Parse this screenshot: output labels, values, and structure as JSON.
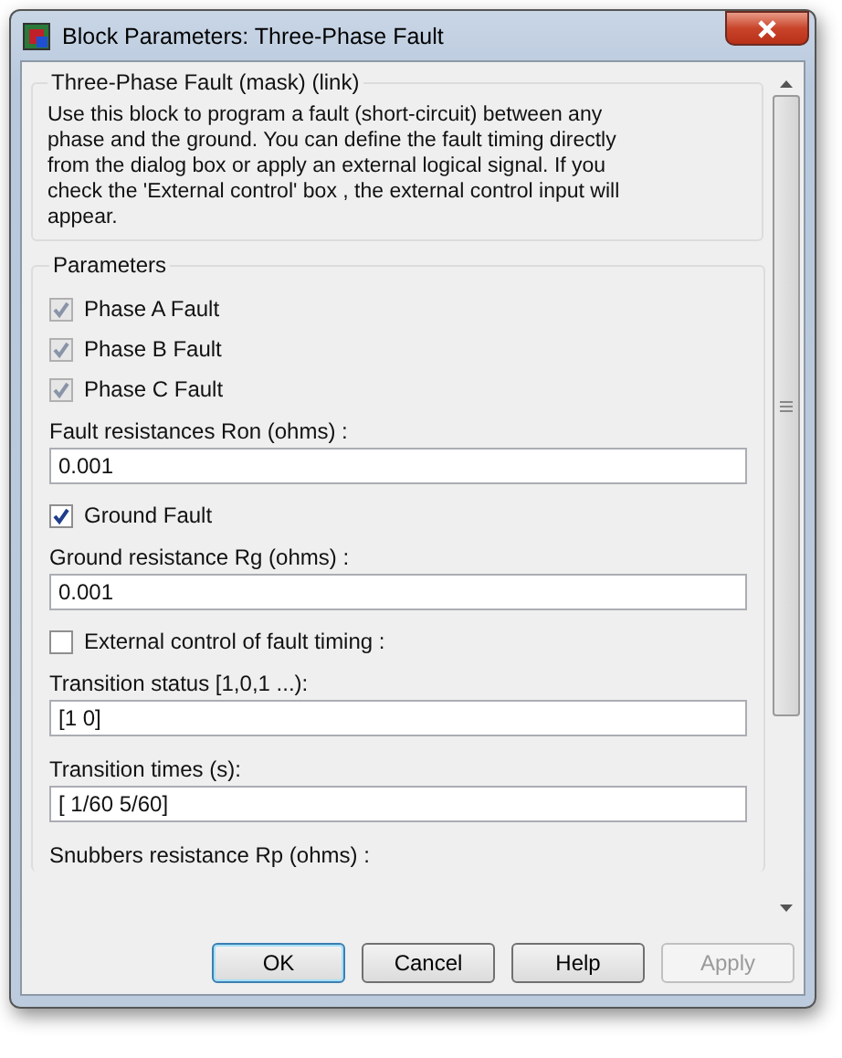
{
  "window": {
    "title": "Block Parameters: Three-Phase Fault"
  },
  "description": {
    "title": "Three-Phase Fault (mask) (link)",
    "text": "Use this block to program a fault (short-circuit) between any phase and the ground. You can define the fault timing directly from the dialog box or apply an external logical signal. If you check the 'External control' box , the external control input will appear."
  },
  "parameters": {
    "title": "Parameters",
    "items": [
      {
        "kind": "checkbox",
        "label": "Phase A Fault",
        "checked": true,
        "disabled": true
      },
      {
        "kind": "checkbox",
        "label": "Phase B Fault",
        "checked": true,
        "disabled": true
      },
      {
        "kind": "checkbox",
        "label": "Phase C Fault",
        "checked": true,
        "disabled": true
      },
      {
        "kind": "field",
        "label": "Fault resistances  Ron (ohms) :",
        "value": "0.001"
      },
      {
        "kind": "checkbox",
        "label": "Ground Fault",
        "checked": true,
        "disabled": false
      },
      {
        "kind": "field",
        "label": "Ground resistance Rg (ohms) :",
        "value": "0.001"
      },
      {
        "kind": "checkbox",
        "label": "External control of fault timing :",
        "checked": false,
        "disabled": false
      },
      {
        "kind": "field",
        "label": "Transition status [1,0,1 ...):",
        "value": "[1 0]"
      },
      {
        "kind": "field",
        "label": "Transition times (s):",
        "value": "[ 1/60 5/60]"
      },
      {
        "kind": "label",
        "label": "Snubbers resistance Rp (ohms) :"
      }
    ]
  },
  "buttons": [
    {
      "label": "OK",
      "default": true,
      "disabled": false
    },
    {
      "label": "Cancel",
      "default": false,
      "disabled": false
    },
    {
      "label": "Help",
      "default": false,
      "disabled": false
    },
    {
      "label": "Apply",
      "default": false,
      "disabled": true
    }
  ]
}
